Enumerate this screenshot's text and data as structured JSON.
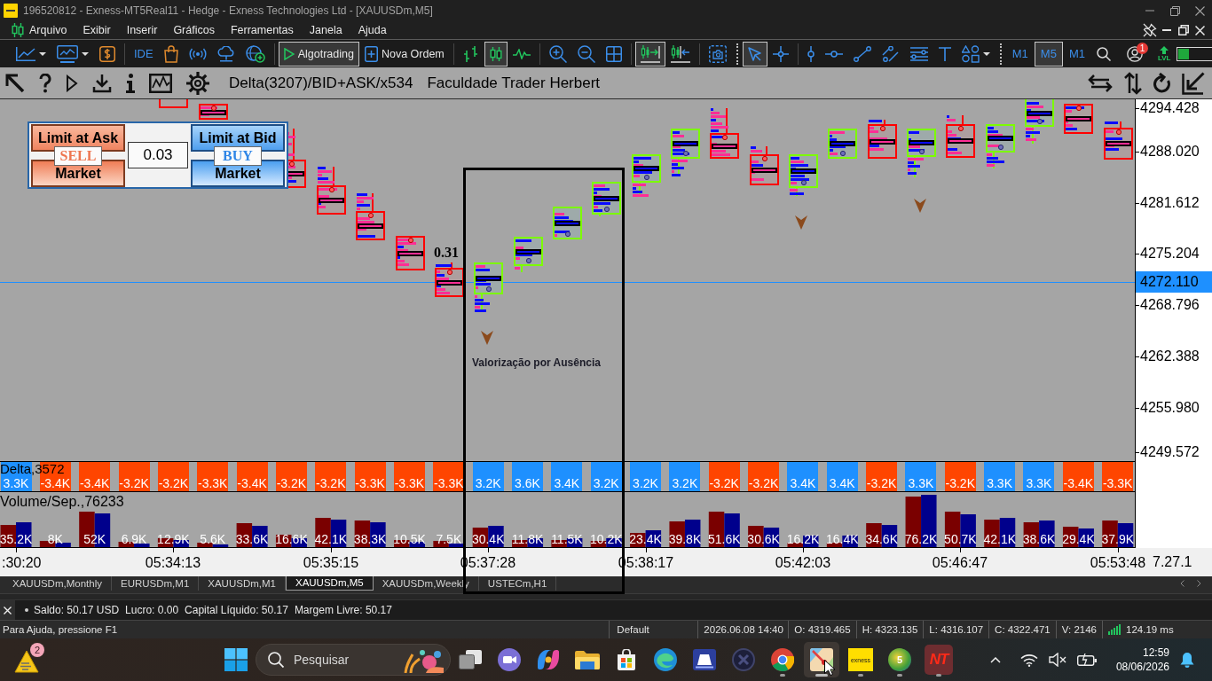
{
  "window": {
    "title": "196520812 - Exness-MT5Real11 - Hedge - Exness Technologies Ltd - [XAUUSDm,M5]"
  },
  "menu": {
    "items": [
      "Arquivo",
      "Exibir",
      "Inserir",
      "Gráficos",
      "Ferramentas",
      "Janela",
      "Ajuda"
    ]
  },
  "toolbar": {
    "buttons": [
      {
        "selected": false
      },
      {
        "selected": false
      },
      {
        "selected": false
      },
      {
        "label": "IDE",
        "selected": false
      },
      {
        "selected": false
      },
      {
        "selected": false
      },
      {
        "selected": false
      },
      {
        "selected": false
      },
      {
        "label": "Algotrading",
        "selected": true
      },
      {
        "label": "Nova Ordem",
        "selected": false
      },
      {
        "selected": false
      },
      {
        "selected": true
      },
      {
        "selected": false
      },
      {
        "selected": false
      },
      {
        "selected": false
      },
      {
        "selected": false
      },
      {
        "selected": true
      },
      {
        "selected": false
      },
      {
        "selected": false
      },
      {
        "selected": true
      },
      {
        "selected": false
      },
      {
        "selected": false
      },
      {
        "selected": false
      },
      {
        "selected": false
      },
      {
        "selected": false
      },
      {
        "selected": false
      },
      {
        "selected": false
      },
      {
        "selected": false
      }
    ],
    "timeframes": [
      {
        "label": "M1",
        "selected": false
      },
      {
        "label": "M5",
        "selected": true
      },
      {
        "label": "M1",
        "selected": false
      }
    ],
    "account_badge": "1",
    "level_label": "LVL",
    "margin_level": {
      "level": 0.3
    }
  },
  "chart": {
    "header": {
      "indicator": "Delta(3207)/BID+ASK/x534",
      "caption": "Faculdade Trader Herbert"
    },
    "order_panel": {
      "sell_limit": "Limit at Ask",
      "sell_tag": "SELL",
      "sell_market": "Market",
      "lot_field": {
        "value": "0.03"
      },
      "buy_limit": "Limit at Bid",
      "buy_tag": "BUY",
      "buy_market": "Market"
    },
    "price_axis": {
      "labels": [
        "4294.428",
        "4288.020",
        "4281.612",
        "4275.204",
        "4268.796",
        "4262.388",
        "4255.980",
        "4249.572"
      ],
      "current_price": "4272.110"
    },
    "value_label": "0.31",
    "annotation": "Valorização por Ausência",
    "delta_pane": {
      "title": "Delta,3572",
      "bars": [
        {
          "label": "3.3K",
          "color": "#1e90ff"
        },
        {
          "label": "-3.4K",
          "color": "#ff4500"
        },
        {
          "label": "-3.4K",
          "color": "#ff4500"
        },
        {
          "label": "-3.2K",
          "color": "#ff4500"
        },
        {
          "label": "-3.2K",
          "color": "#ff4500"
        },
        {
          "label": "-3.3K",
          "color": "#ff4500"
        },
        {
          "label": "-3.4K",
          "color": "#ff4500"
        },
        {
          "label": "-3.2K",
          "color": "#ff4500"
        },
        {
          "label": "-3.2K",
          "color": "#ff4500"
        },
        {
          "label": "-3.3K",
          "color": "#ff4500"
        },
        {
          "label": "-3.3K",
          "color": "#ff4500"
        },
        {
          "label": "-3.3K",
          "color": "#ff4500"
        },
        {
          "label": "3.2K",
          "color": "#1e90ff"
        },
        {
          "label": "3.6K",
          "color": "#1e90ff"
        },
        {
          "label": "3.4K",
          "color": "#1e90ff"
        },
        {
          "label": "3.2K",
          "color": "#1e90ff"
        },
        {
          "label": "3.2K",
          "color": "#1e90ff"
        },
        {
          "label": "3.2K",
          "color": "#1e90ff"
        },
        {
          "label": "-3.2K",
          "color": "#ff4500"
        },
        {
          "label": "-3.2K",
          "color": "#ff4500"
        },
        {
          "label": "3.4K",
          "color": "#1e90ff"
        },
        {
          "label": "3.4K",
          "color": "#1e90ff"
        },
        {
          "label": "-3.2K",
          "color": "#ff4500"
        },
        {
          "label": "3.3K",
          "color": "#1e90ff"
        },
        {
          "label": "-3.2K",
          "color": "#ff4500"
        },
        {
          "label": "3.3K",
          "color": "#1e90ff"
        },
        {
          "label": "3.3K",
          "color": "#1e90ff"
        },
        {
          "label": "-3.4K",
          "color": "#ff4500"
        },
        {
          "label": "-3.3K",
          "color": "#ff4500"
        }
      ]
    },
    "volume_pane": {
      "title": "Volume/Sep.,76233",
      "bars": [
        "35.2K",
        "8K",
        "52K",
        "6.9K",
        "12.9K",
        "5.6K",
        "33.6K",
        "16.6K",
        "42.1K",
        "38.3K",
        "10.5K",
        "7.5K",
        "30.4K",
        "11.8K",
        "11.5K",
        "10.2K",
        "23.4K",
        "39.8K",
        "51.6K",
        "30.6K",
        "16.2K",
        "16.4K",
        "34.6K",
        "76.2K",
        "50.7K",
        "42.1K",
        "38.6K",
        "29.4K",
        "37.9K"
      ]
    },
    "time_axis": {
      "labels": [
        ":30:20",
        "05:34:13",
        "05:35:15",
        "05:37:28",
        "05:38:17",
        "05:42:03",
        "05:46:47",
        "05:53:48"
      ],
      "corner_label": "7.27.1"
    }
  },
  "chart_tabs": [
    {
      "label": "XAUUSDm,Monthly",
      "selected": false
    },
    {
      "label": "EURUSDm,M1",
      "selected": false
    },
    {
      "label": "XAUUSDm,M1",
      "selected": false
    },
    {
      "label": "XAUUSDm,M5",
      "selected": true
    },
    {
      "label": "XAUUSDm,Weekly",
      "selected": false
    },
    {
      "label": "USTECm,H1",
      "selected": false
    }
  ],
  "account_bar": {
    "items": [
      "Saldo: 50.17 USD",
      "Lucro: 0.00",
      "Capital Líquido: 50.17",
      "Margem Livre: 50.17"
    ]
  },
  "status_bar": {
    "help": "Para Ajuda, pressione F1",
    "profile": "Default",
    "fields": [
      "2026.06.08 14:40",
      "O: 4319.465",
      "H: 4323.135",
      "L: 4316.107",
      "C: 4322.471",
      "V: 2146"
    ],
    "ping": "124.19 ms"
  },
  "taskbar": {
    "weather_badge": "2",
    "search": {
      "placeholder": "Pesquisar"
    },
    "apps": [
      {
        "running": false,
        "selected": false
      },
      {
        "running": false,
        "selected": false
      },
      {
        "running": false,
        "selected": false
      },
      {
        "running": false,
        "selected": false
      },
      {
        "running": false,
        "selected": false
      },
      {
        "running": false,
        "selected": false
      },
      {
        "running": false,
        "selected": false
      },
      {
        "running": false,
        "selected": false
      },
      {
        "running": true,
        "selected": false
      },
      {
        "running": true,
        "selected": true
      },
      {
        "label": "exness",
        "running": true,
        "selected": false
      },
      {
        "label": "5",
        "running": true,
        "selected": false
      },
      {
        "label": "NT",
        "running": true,
        "selected": false
      }
    ],
    "clock": {
      "time": "12:59",
      "date": "08/06/2026"
    }
  }
}
